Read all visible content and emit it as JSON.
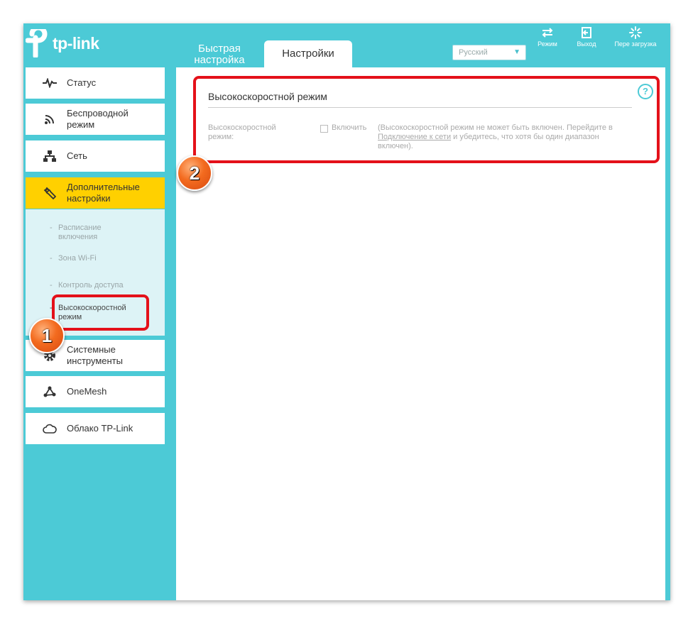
{
  "brand": {
    "logo_text": "tp-link"
  },
  "tabs": {
    "quick_setup": "Быстрая настройка",
    "settings": "Настройки"
  },
  "language": {
    "selected": "Русский"
  },
  "header_buttons": {
    "mode": "Режим",
    "logout": "Выход",
    "reboot": "Пере загрузка"
  },
  "sidebar": {
    "status": "Статус",
    "wireless": "Беспроводной режим",
    "network": "Сеть",
    "advanced": "Дополнительные настройки",
    "sub": {
      "schedule": "Расписание включения",
      "wifi_zone": "Зона Wi-Fi",
      "access_control": "Контроль доступа",
      "high_speed": "Высокоскоростной режим"
    },
    "system_tools": "Системные инструменты",
    "onemesh": "OneMesh",
    "cloud": "Облако TP-Link"
  },
  "content": {
    "section_title": "Высокоскоростной режим",
    "help_symbol": "?",
    "field_label": "Высокоскоростной режим:",
    "checkbox_label": "Включить",
    "note_before": "(Высокоскоростной режим не может быть включен. Перейдите в ",
    "note_link": "Подключение к сети",
    "note_after": " и убедитесь, что хотя бы один диапазон включен)."
  },
  "annotations": {
    "badge1": "1",
    "badge2": "2"
  },
  "colors": {
    "frame": "#4ccad6",
    "active_nav": "#ffd000",
    "highlight": "#e4111a",
    "badge": "#f36b1f"
  }
}
